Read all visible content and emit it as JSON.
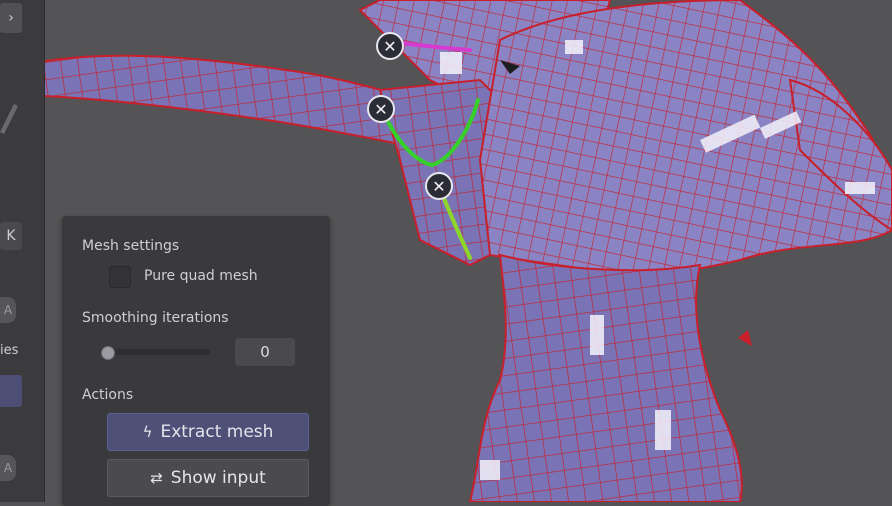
{
  "left_strip": {
    "expand_icon": "chevron-right-icon",
    "key_label": "K",
    "partial_label": "ies"
  },
  "panel": {
    "mesh_settings_title": "Mesh settings",
    "pure_quad_label": "Pure quad mesh",
    "pure_quad_checked": false,
    "smoothing_title": "Smoothing iterations",
    "smoothing_value": "0",
    "smoothing_slider_fraction": 0,
    "actions_title": "Actions",
    "extract_label": "Extract mesh",
    "extract_icon": "lightning-icon",
    "show_input_label": "Show input",
    "show_input_icon": "shuffle-icon"
  },
  "viewport": {
    "handle_icon": "close-icon",
    "handle_count": 3,
    "mesh_fill": "#7a74b6",
    "wire_color": "#c81f2a",
    "guide_colors": [
      "#d63ad0",
      "#35d12a",
      "#8fd62a"
    ]
  }
}
